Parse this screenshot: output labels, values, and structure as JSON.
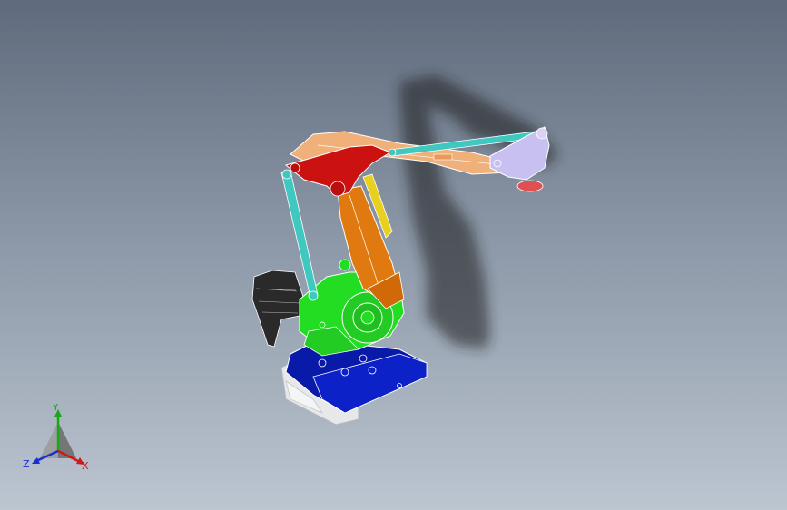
{
  "viewport": {
    "background_top": "#5f6b7c",
    "background_bottom": "#bcc5d0"
  },
  "model": {
    "parts": [
      {
        "name": "base-plate",
        "color": "#0a1aa8"
      },
      {
        "name": "base-frame",
        "color": "#e6e8ea"
      },
      {
        "name": "turntable",
        "color": "#22dd22"
      },
      {
        "name": "lower-arm",
        "color": "#e07a10"
      },
      {
        "name": "upper-link",
        "color": "#cc1111"
      },
      {
        "name": "upper-arm",
        "color": "#f0b07a"
      },
      {
        "name": "tie-rods",
        "color": "#3ec8c0"
      },
      {
        "name": "wrist",
        "color": "#c7c0f0"
      },
      {
        "name": "flange",
        "color": "#e05050"
      },
      {
        "name": "counterweight",
        "color": "#2a2a2a"
      },
      {
        "name": "cylinder",
        "color": "#e8d020"
      }
    ]
  },
  "triad": {
    "y_label": "Y",
    "x_label": "X",
    "z_label": "Z",
    "y_color": "#1aa81a",
    "x_color": "#d01818",
    "z_color": "#1830d0"
  }
}
